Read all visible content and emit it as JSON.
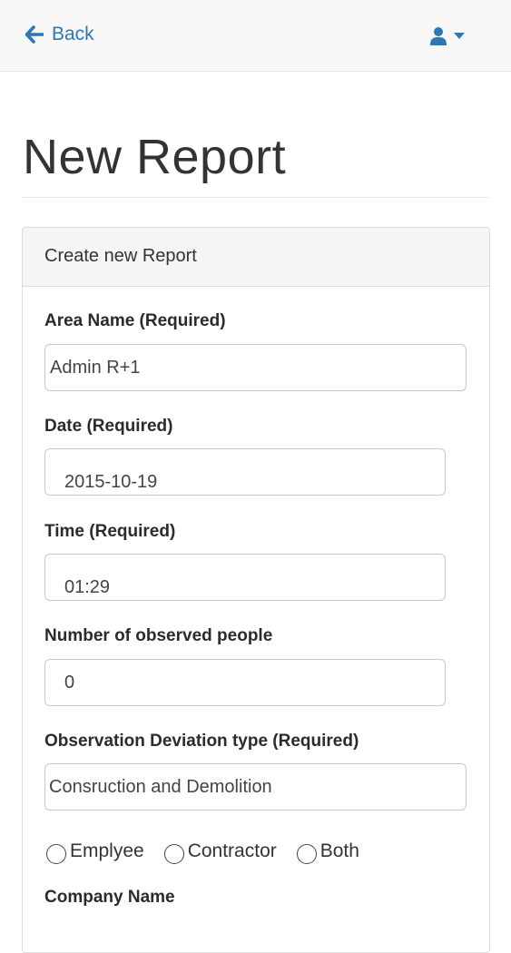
{
  "nav": {
    "back_label": "Back",
    "user_icon": "user-icon",
    "caret_icon": "caret-down-icon",
    "accent": "#2a78b8"
  },
  "page": {
    "title": "New Report"
  },
  "panel": {
    "heading": "Create new Report"
  },
  "form": {
    "area_name": {
      "label": "Area Name (Required)",
      "value": "Admin R+1"
    },
    "date": {
      "label": "Date (Required)",
      "value": "2015-10-19"
    },
    "time": {
      "label": "Time (Required)",
      "value": "01:29"
    },
    "observed_people": {
      "label": "Number of observed people",
      "value": "0"
    },
    "deviation_type": {
      "label": "Observation Deviation type (Required)",
      "value": "Consruction and Demolition"
    },
    "worker_type": {
      "options": [
        "Emplyee",
        "Contractor",
        "Both"
      ]
    },
    "company_name": {
      "label": "Company Name"
    }
  }
}
